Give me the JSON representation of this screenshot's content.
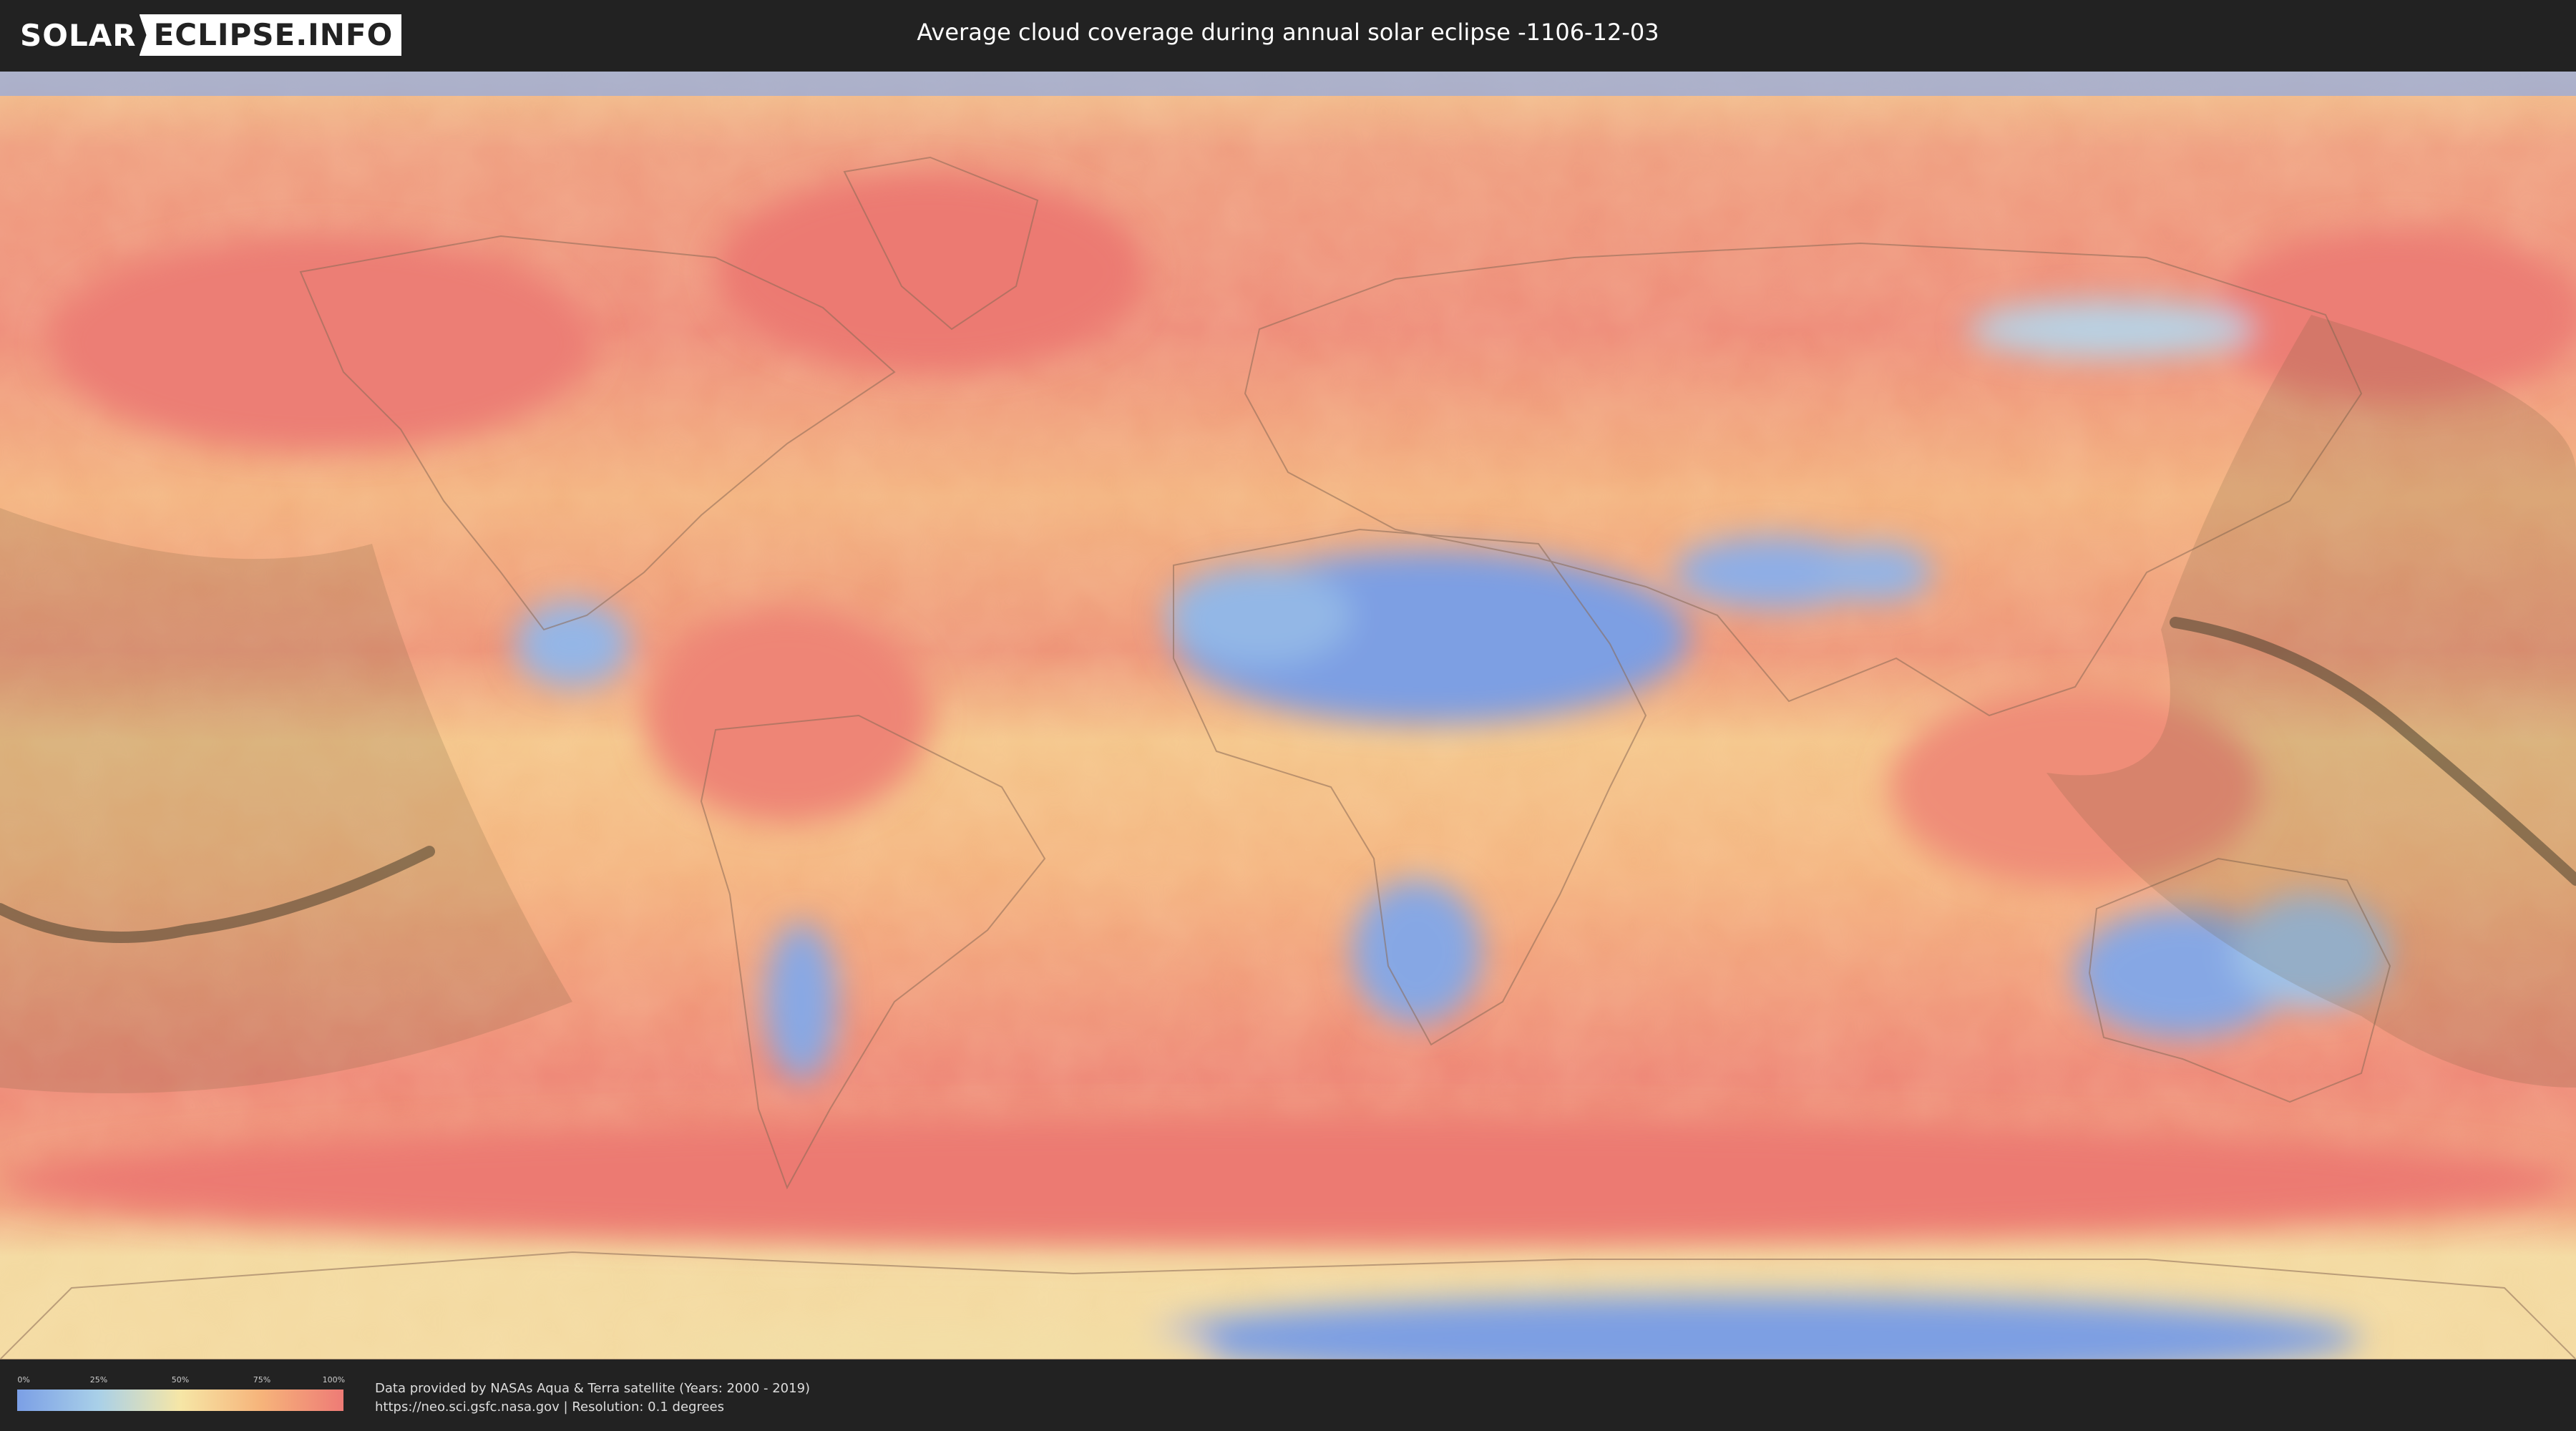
{
  "header": {
    "logo_left": "SOLAR",
    "logo_right": "ECLIPSE.INFO",
    "title": "Average cloud coverage during annual solar eclipse -1106-12-03"
  },
  "map": {
    "projection": "equirectangular",
    "layer": "average cloud coverage",
    "overlay": "annular solar eclipse path and visibility zone"
  },
  "legend": {
    "ticks": [
      "0%",
      "25%",
      "50%",
      "75%",
      "100%"
    ],
    "colors": [
      "#7b9fe6",
      "#a9d0e8",
      "#f6e6a6",
      "#f6b37a",
      "#ee7b76"
    ]
  },
  "footer": {
    "source_line1": "Data provided by NASAs Aqua & Terra satellite (Years: 2000 - 2019)",
    "source_line2": "https://neo.sci.gsfc.nasa.gov | Resolution: 0.1 degrees"
  },
  "colors": {
    "background": "#222222",
    "low_cloud": "#7b9fe6",
    "high_cloud": "#ee7b76"
  }
}
